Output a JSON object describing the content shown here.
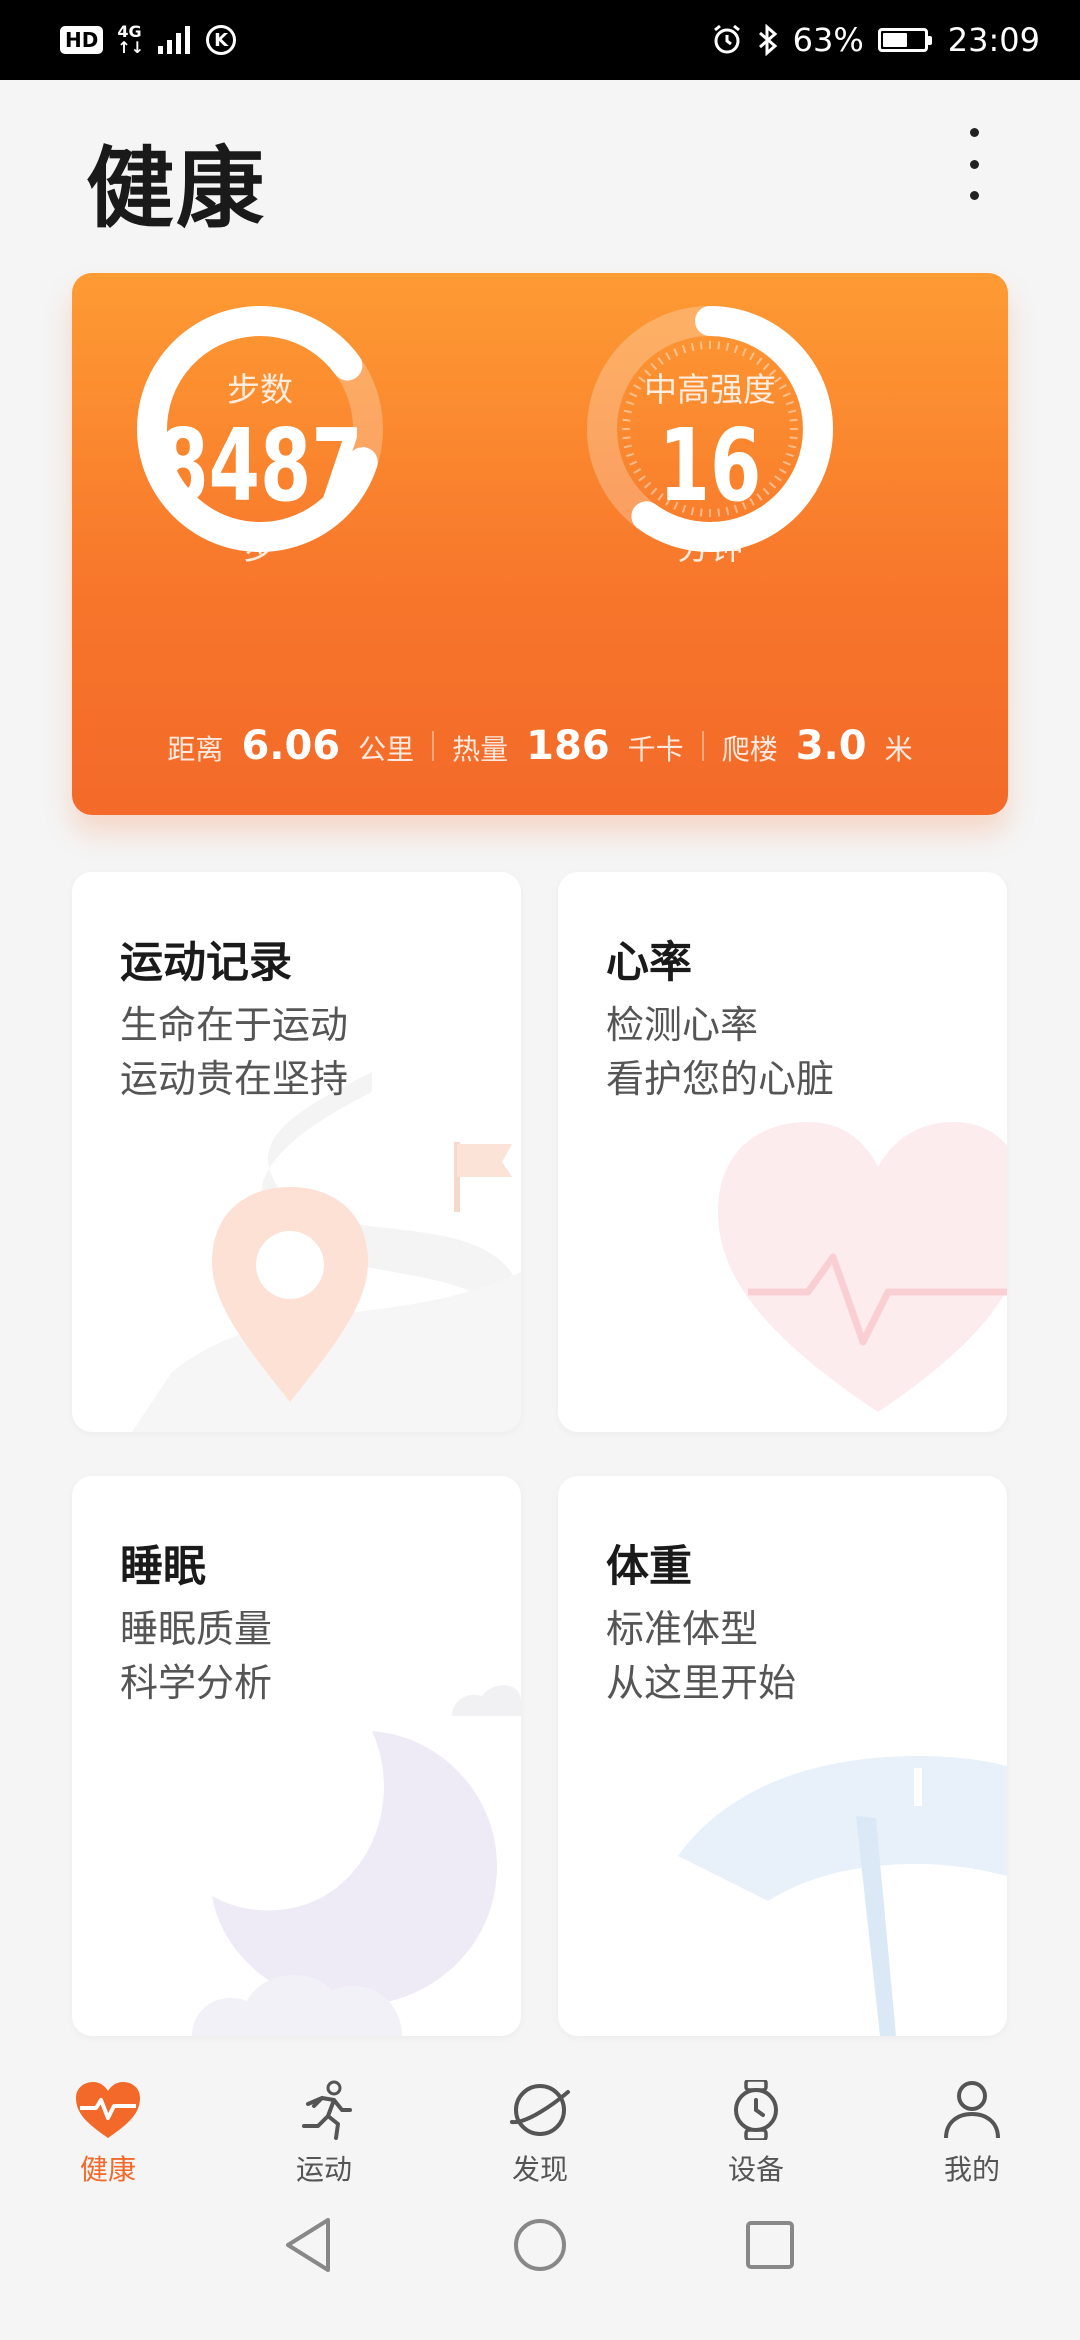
{
  "status_bar": {
    "hd": "HD",
    "network_top": "4G",
    "network_bottom": "↑↓",
    "k": "K",
    "battery_pct": "63%",
    "battery_level": 0.63,
    "time": "23:09"
  },
  "header": {
    "title": "健康"
  },
  "activity": {
    "steps": {
      "label": "步数",
      "value": "8487",
      "unit": "步",
      "progress": 0.85
    },
    "intensity": {
      "label": "中高强度",
      "value": "16",
      "unit": "分钟",
      "progress": 0.6
    },
    "stats": [
      {
        "label": "距离",
        "value": "6.06",
        "unit": "公里"
      },
      {
        "label": "热量",
        "value": "186",
        "unit": "千卡"
      },
      {
        "label": "爬楼",
        "value": "3.0",
        "unit": "米"
      }
    ]
  },
  "cards": {
    "exercise": {
      "title": "运动记录",
      "line1": "生命在于运动",
      "line2": "运动贵在坚持"
    },
    "heart": {
      "title": "心率",
      "line1": "检测心率",
      "line2": "看护您的心脏"
    },
    "sleep": {
      "title": "睡眠",
      "line1": "睡眠质量",
      "line2": "科学分析"
    },
    "weight": {
      "title": "体重",
      "line1": "标准体型",
      "line2": "从这里开始"
    }
  },
  "nav": {
    "health": "健康",
    "sport": "运动",
    "discover": "发现",
    "device": "设备",
    "me": "我的"
  },
  "colors": {
    "accent": "#f2692a",
    "card_top": "#fe9b33",
    "card_bottom": "#f36a29"
  }
}
